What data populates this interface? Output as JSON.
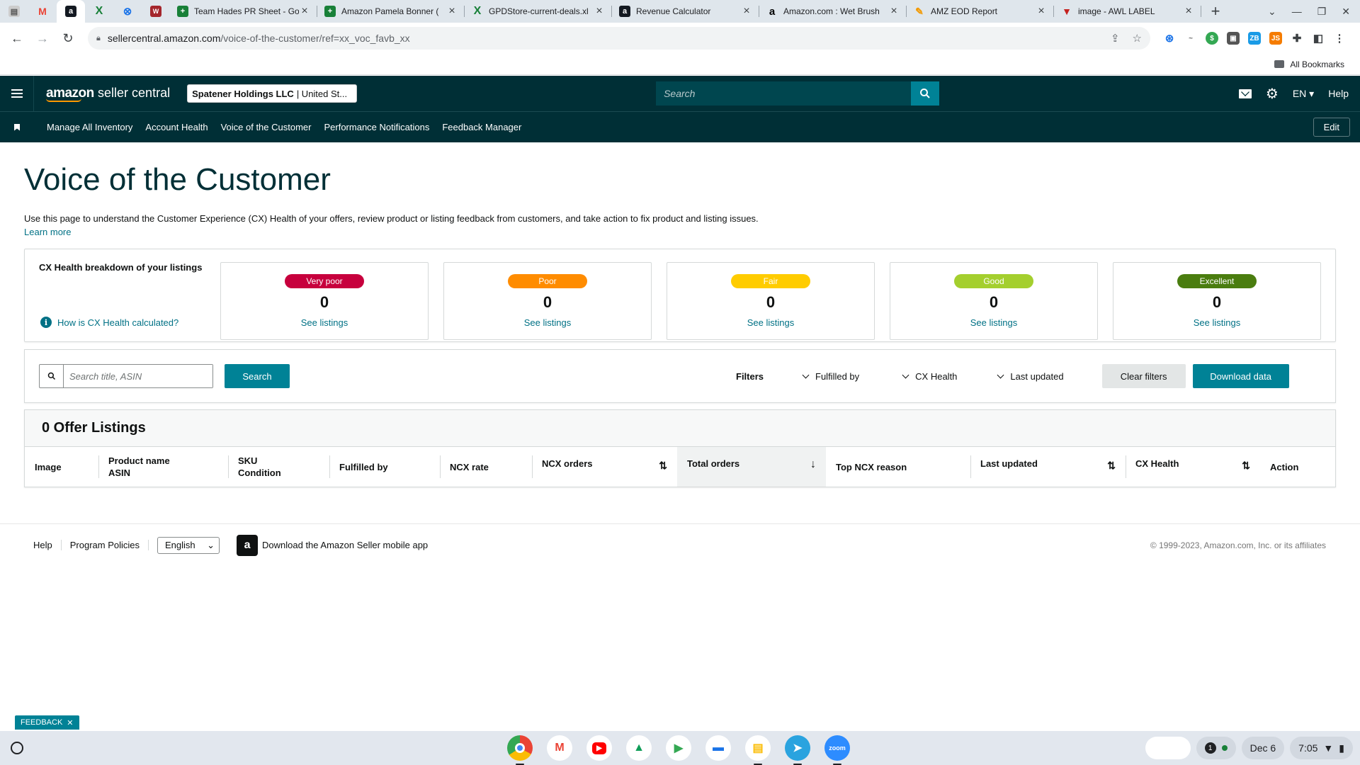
{
  "browser": {
    "tabs": [
      {
        "title": "Team Hades PR Sheet - Go",
        "icon": "sheets-icon"
      },
      {
        "title": "Amazon Pamela Bonner (",
        "icon": "sheets-icon"
      },
      {
        "title": "GPDStore-current-deals.xl",
        "icon": "excel-icon"
      },
      {
        "title": "Revenue Calculator",
        "icon": "amazon-icon"
      },
      {
        "title": "Amazon.com : Wet Brush",
        "icon": "amazon-icon"
      },
      {
        "title": "AMZ EOD Report",
        "icon": "report-icon"
      },
      {
        "title": "image - AWL LABEL",
        "icon": "awl-icon"
      }
    ],
    "url_host": "sellercentral.amazon.com",
    "url_path": "/voice-of-the-customer/ref=xx_voc_favb_xx",
    "bookmarks_label": "All Bookmarks"
  },
  "header": {
    "logo_brand": "amazon",
    "logo_sub": "seller central",
    "account_name": "Spatener Holdings LLC",
    "account_region": "| United St...",
    "search_placeholder": "Search",
    "language": "EN",
    "help": "Help"
  },
  "nav": {
    "links": [
      "Manage All Inventory",
      "Account Health",
      "Voice of the Customer",
      "Performance Notifications",
      "Feedback Manager"
    ],
    "edit": "Edit"
  },
  "page": {
    "title": "Voice of the Customer",
    "description": "Use this page to understand the Customer Experience (CX) Health of your offers, review product or listing feedback from customers, and take action to fix product and listing issues.",
    "learn_more": "Learn more"
  },
  "cx_health": {
    "title": "CX Health breakdown of your listings",
    "help_link": "How is CX Health calculated?",
    "cards": [
      {
        "label": "Very poor",
        "count": "0",
        "link": "See listings",
        "color": "#c7003d"
      },
      {
        "label": "Poor",
        "count": "0",
        "link": "See listings",
        "color": "#ff8c00"
      },
      {
        "label": "Fair",
        "count": "0",
        "link": "See listings",
        "color": "#ffcc00"
      },
      {
        "label": "Good",
        "count": "0",
        "link": "See listings",
        "color": "#a4cf2e"
      },
      {
        "label": "Excellent",
        "count": "0",
        "link": "See listings",
        "color": "#4a7d0f"
      }
    ]
  },
  "filters": {
    "search_placeholder": "Search title, ASIN",
    "search_button": "Search",
    "label": "Filters",
    "dropdowns": [
      "Fulfilled by",
      "CX Health",
      "Last updated"
    ],
    "clear": "Clear filters",
    "download": "Download data"
  },
  "listings": {
    "heading": "0 Offer Listings",
    "columns": {
      "image": "Image",
      "product_name": "Product name",
      "asin": "ASIN",
      "sku": "SKU",
      "condition": "Condition",
      "fulfilled_by": "Fulfilled by",
      "ncx_rate": "NCX rate",
      "ncx_orders": "NCX orders",
      "total_orders": "Total orders",
      "top_ncx_reason": "Top NCX reason",
      "last_updated": "Last updated",
      "cx_health": "CX Health",
      "action": "Action"
    }
  },
  "footer": {
    "help": "Help",
    "program_policies": "Program Policies",
    "language": "English",
    "app_text": "Download the Amazon Seller mobile app",
    "copyright": "© 1999-2023, Amazon.com, Inc. or its affiliates"
  },
  "feedback_tab": "FEEDBACK",
  "shelf": {
    "date": "Dec 6",
    "time": "7:05",
    "notifications": "1"
  },
  "colors": {
    "header_bg": "#002f36",
    "accent": "#008296",
    "link": "#007185"
  }
}
